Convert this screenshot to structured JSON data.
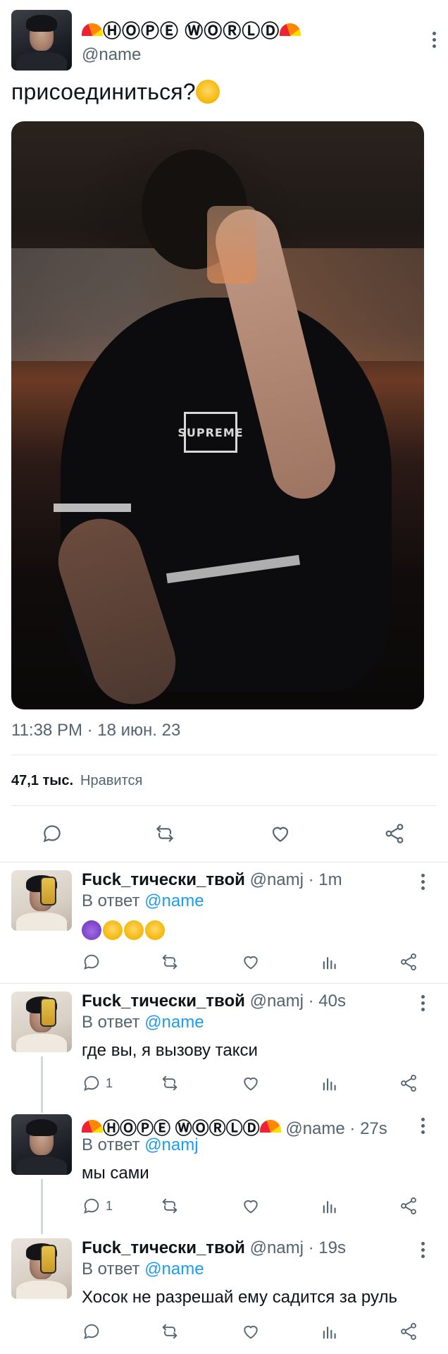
{
  "main_tweet": {
    "display_name": "ⒽⓄⓅⒺ ⓌⓄⓇⓁⒹ",
    "handle": "@name",
    "text": "присоединиться?",
    "media_logo": "SUPREME",
    "timestamp": "11:38 PM · 18 июн. 23",
    "likes_count": "47,1 тыс.",
    "likes_label": "Нравится"
  },
  "replies": [
    {
      "display_name": "Fuck_тически_твой",
      "handle": "@namj",
      "time": "· 1m",
      "replying_prefix": "В ответ",
      "mention": "@name",
      "text": "",
      "reply_count": "",
      "emojis": [
        "devil",
        "huff",
        "huff",
        "huff"
      ]
    },
    {
      "display_name": "Fuck_тически_твой",
      "handle": "@namj",
      "time": "· 40s",
      "replying_prefix": "В ответ",
      "mention": "@name",
      "text": "где вы, я вызову такси",
      "reply_count": "1"
    },
    {
      "display_name": "ⒽⓄⓅⒺ ⓌⓄⓇⓁⒹ",
      "handle": "@name",
      "time": "· 27s",
      "replying_prefix": "В ответ",
      "mention": "@namj",
      "text": "мы сами",
      "reply_count": "1"
    },
    {
      "display_name": "Fuck_тически_твой",
      "handle": "@namj",
      "time": "· 19s",
      "replying_prefix": "В ответ",
      "mention": "@name",
      "text": "Хосок не разрешай ему садится за руль",
      "reply_count": ""
    }
  ],
  "icons": [
    "reply-icon",
    "retweet-icon",
    "like-icon",
    "share-icon",
    "views-icon",
    "more-icon"
  ],
  "colors": {
    "text": "#0f1419",
    "secondary": "#536471",
    "link": "#1d9bf0",
    "divider": "#e6e9ec"
  }
}
